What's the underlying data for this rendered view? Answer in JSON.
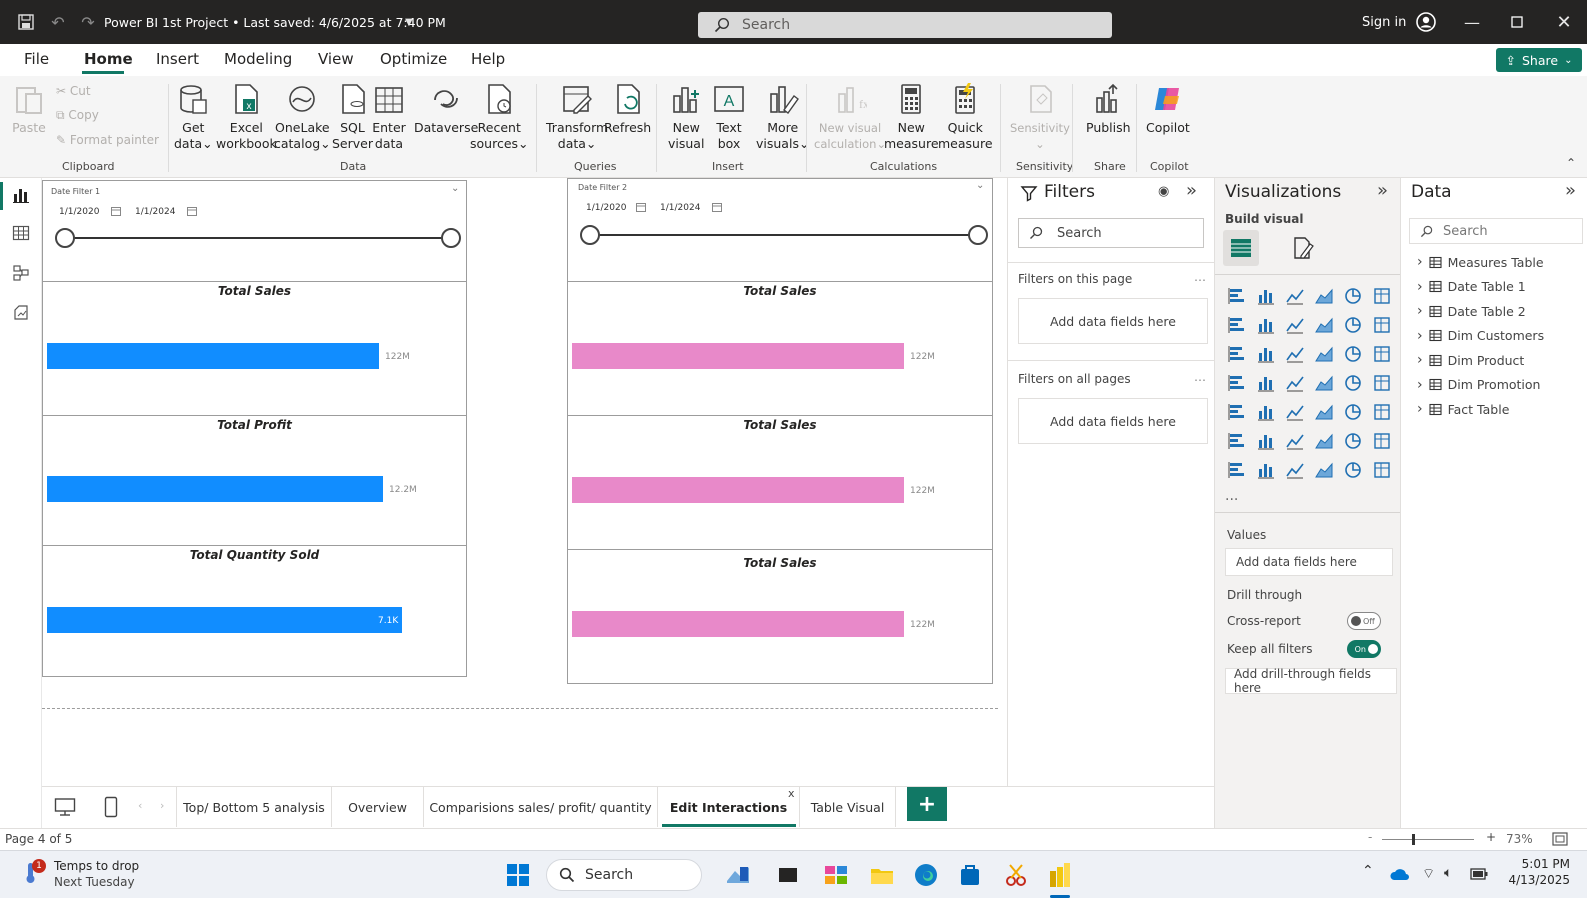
{
  "titlebar": {
    "title": "Power BI 1st Project • Last saved: 4/6/2025 at 7:40 PM",
    "search_placeholder": "Search",
    "sign_in": "Sign in"
  },
  "menu": {
    "tabs": [
      "File",
      "Home",
      "Insert",
      "Modeling",
      "View",
      "Optimize",
      "Help"
    ],
    "share": "Share"
  },
  "ribbon": {
    "clipboard": {
      "paste": "Paste",
      "cut": "Cut",
      "copy": "Copy",
      "format_painter": "Format painter",
      "label": "Clipboard"
    },
    "data": {
      "get_data": [
        "Get",
        "data"
      ],
      "excel": [
        "Excel",
        "workbook"
      ],
      "onelake": [
        "OneLake",
        "catalog"
      ],
      "sql": [
        "SQL",
        "Server"
      ],
      "enter": [
        "Enter",
        "data"
      ],
      "dataverse": [
        "Dataverse",
        ""
      ],
      "recent": [
        "Recent",
        "sources"
      ],
      "label": "Data"
    },
    "queries": {
      "transform": [
        "Transform",
        "data"
      ],
      "refresh": [
        "Refresh",
        ""
      ],
      "label": "Queries"
    },
    "insert": {
      "new_visual": [
        "New",
        "visual"
      ],
      "text_box": [
        "Text",
        "box"
      ],
      "more_visuals": [
        "More",
        "visuals"
      ],
      "label": "Insert"
    },
    "calculations": {
      "new_visual_calc": [
        "New visual",
        "calculation"
      ],
      "new_measure": [
        "New",
        "measure"
      ],
      "quick_measure": [
        "Quick",
        "measure"
      ],
      "label": "Calculations"
    },
    "sensitivity": {
      "btn": [
        "Sensitivity",
        ""
      ],
      "label": "Sensitivity"
    },
    "share": {
      "publish": [
        "Publish",
        ""
      ],
      "label": "Share"
    },
    "copilot": {
      "btn": [
        "Copilot",
        ""
      ],
      "label": "Copilot"
    }
  },
  "canvas": {
    "left": {
      "slicer_title": "Date Filter 1",
      "start_date": "1/1/2020",
      "end_date": "1/1/2024",
      "charts": [
        {
          "title": "Total Sales",
          "value_label": "122M",
          "fill": 0.81
        },
        {
          "title": "Total Profit",
          "value_label": "12.2M",
          "fill": 0.82
        },
        {
          "title": "Total Quantity Sold",
          "value_label": "7.1K",
          "fill": 0.865
        }
      ],
      "color": "#118DFF"
    },
    "right": {
      "slicer_title": "Date Filter 2",
      "start_date": "1/1/2020",
      "end_date": "1/1/2024",
      "charts": [
        {
          "title": "Total Sales",
          "value_label": "122M",
          "fill": 0.81
        },
        {
          "title": "Total Sales",
          "value_label": "122M",
          "fill": 0.81
        },
        {
          "title": "Total Sales",
          "value_label": "122M",
          "fill": 0.81
        }
      ],
      "color": "#E889C9"
    }
  },
  "filters": {
    "title": "Filters",
    "search_placeholder": "Search",
    "on_this_page": "Filters on this page",
    "on_all_pages": "Filters on all pages",
    "add_fields": "Add data fields here"
  },
  "visualizations": {
    "title": "Visualizations",
    "build_visual": "Build visual",
    "values": "Values",
    "values_placeholder": "Add data fields here",
    "drill_through": "Drill through",
    "cross_report": "Cross-report",
    "cross_report_state": "Off",
    "keep_all_filters": "Keep all filters",
    "keep_all_filters_state": "On",
    "drill_placeholder": "Add drill-through fields here",
    "more": "..."
  },
  "data_pane": {
    "title": "Data",
    "search_placeholder": "Search",
    "tables": [
      "Measures Table",
      "Date Table 1",
      "Date Table 2",
      "Dim Customers",
      "Dim Product",
      "Dim Promotion",
      "Fact Table"
    ]
  },
  "page_tabs": {
    "tabs": [
      "Top/ Bottom 5 analysis",
      "Overview",
      "Comparisions sales/ profit/ quantity",
      "Edit Interactions",
      "Table Visual"
    ],
    "active": "Edit Interactions",
    "close": "x",
    "add": "+"
  },
  "status": {
    "page": "Page 4 of 5",
    "zoom": "73%",
    "minus": "-",
    "plus": "+"
  },
  "taskbar": {
    "weather_badge": "1",
    "weather_line1": "Temps to drop",
    "weather_line2": "Next Tuesday",
    "search": "Search",
    "time": "5:01 PM",
    "date": "4/13/2025"
  }
}
